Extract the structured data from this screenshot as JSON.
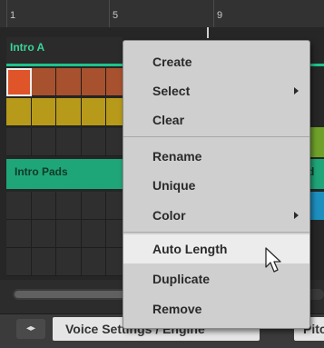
{
  "ruler": {
    "marks": [
      "1",
      "5",
      "9"
    ]
  },
  "scene": {
    "label": "Intro A"
  },
  "pattern": {
    "label": "Intro Pads",
    "label_right_fragment": "d"
  },
  "bottom": {
    "tab_voice_label": "Voice Settings / Engine",
    "tab_pitch_label": "Pitch",
    "nav_arrows": "◂▸"
  },
  "menu": {
    "items": [
      "Create",
      "Select",
      "Clear",
      "Rename",
      "Unique",
      "Color",
      "Auto Length",
      "Duplicate",
      "Remove"
    ],
    "submenu_items": [
      "Select",
      "Color"
    ],
    "highlighted_item": "Auto Length"
  },
  "colors": {
    "scene_accent": "#1fc48a",
    "pattern_bar": "#1fa678",
    "menu_bg": "#cfcfcf",
    "menu_highlight": "#ececec",
    "kick_cell": "#e0542a",
    "row1_cell": "#a8512e",
    "row2_cell": "#b89a1a",
    "row4_cell": "#1d8fbf"
  }
}
